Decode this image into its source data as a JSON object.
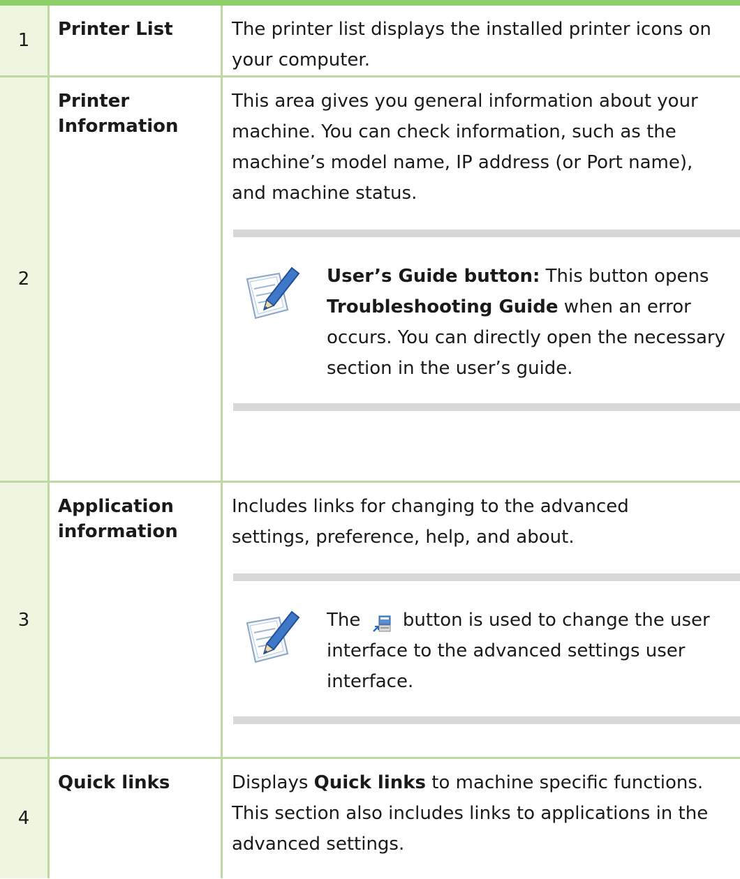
{
  "rows": [
    {
      "num": "1",
      "name": "Printer List",
      "desc": "The printer list displays the installed printer icons on your computer."
    },
    {
      "num": "2",
      "name": "Printer Information",
      "desc": "This area gives you general information about your machine. You can check information, such as the machine’s model name, IP address (or Port name), and machine status.",
      "note": {
        "bold1": "User’s Guide button:",
        "text1": " This button opens ",
        "bold2": "Troubleshooting Guide",
        "text2": " when an error occurs. You can directly open the necessary section in the user’s guide."
      }
    },
    {
      "num": "3",
      "name": "Application information",
      "desc": "Includes links for changing to the advanced settings, preference, help, and about.",
      "note": {
        "pre": "The",
        "post": "button is used to change the user interface to the advanced settings user interface."
      }
    },
    {
      "num": "4",
      "name": "Quick links",
      "desc_pre": "Displays ",
      "desc_bold": "Quick links",
      "desc_post": " to machine specific functions. This section also includes links to applications in the advanced settings."
    }
  ],
  "icons": {
    "note": "note-pencil-icon",
    "advanced": "advanced-settings-icon"
  },
  "colors": {
    "accent": "#8fcf6a",
    "num_bg": "#eef6e0",
    "border": "#bcd9a0",
    "note_bar": "#d8d8d8"
  }
}
